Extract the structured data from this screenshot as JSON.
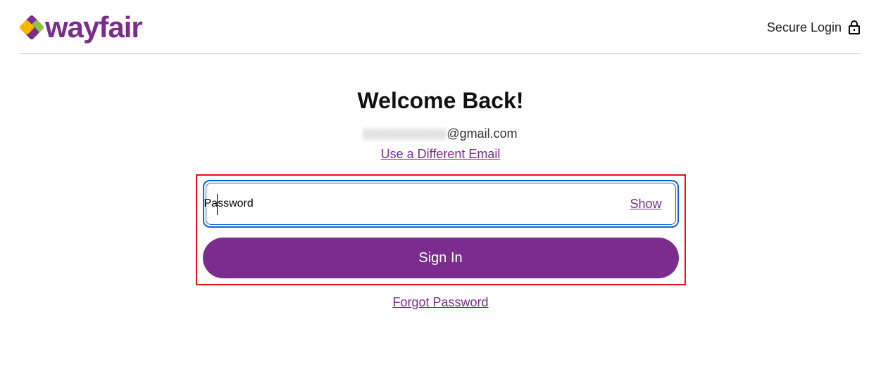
{
  "header": {
    "brand_name": "wayfair",
    "secure_label": "Secure Login"
  },
  "main": {
    "heading": "Welcome Back!",
    "email_suffix": "@gmail.com",
    "different_email_label": "Use a Different Email",
    "password_label": "Password",
    "password_value": "",
    "show_label": "Show",
    "signin_label": "Sign In",
    "forgot_label": "Forgot Password"
  },
  "colors": {
    "brand": "#7b2d8e",
    "focus": "#1463d6",
    "highlight": "#e11"
  }
}
